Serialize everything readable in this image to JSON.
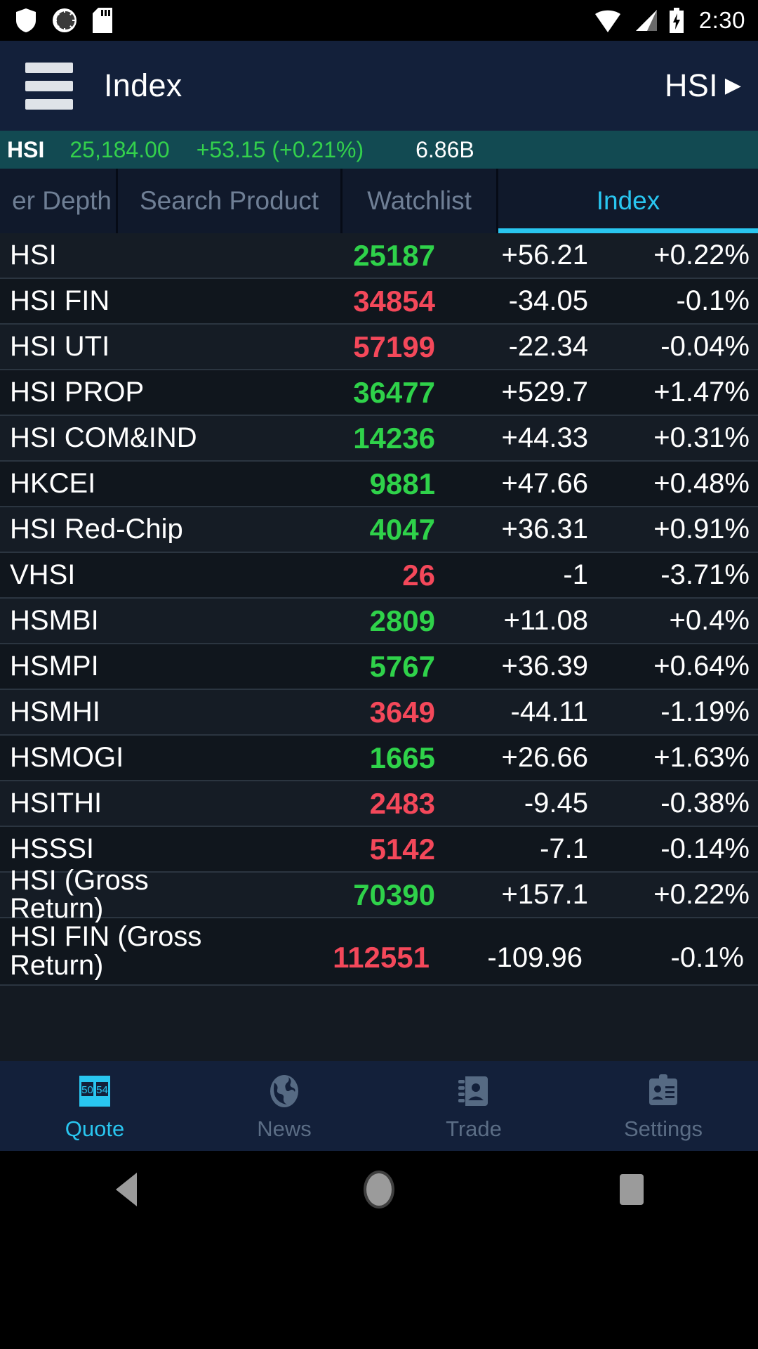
{
  "status_bar": {
    "icons_left": [
      "shield-icon",
      "loading-spinner-icon",
      "sd-card-icon"
    ],
    "icons_right": [
      "wifi-icon",
      "signal-icon",
      "battery-charging-icon"
    ],
    "time": "2:30"
  },
  "app_bar": {
    "menu_icon": "hamburger-menu-icon",
    "title": "Index",
    "symbol": "HSI",
    "arrow_icon": "play-arrow-icon",
    "arrow_glyph": "▶"
  },
  "ticker": {
    "symbol": "HSI",
    "last": "25,184.00",
    "change": "+53.15 (+0.21%)",
    "volume": "6.86B",
    "up_color": "#33d14c"
  },
  "tabs": [
    {
      "label": "er Depth",
      "active": false
    },
    {
      "label": "Search Product",
      "active": false
    },
    {
      "label": "Watchlist",
      "active": false
    },
    {
      "label": "Index",
      "active": true
    }
  ],
  "list": {
    "rows": [
      {
        "name": "HSI",
        "price": "25187",
        "change": "+56.21",
        "percent": "+0.22%",
        "dir": "up"
      },
      {
        "name": "HSI FIN",
        "price": "34854",
        "change": "-34.05",
        "percent": "-0.1%",
        "dir": "down"
      },
      {
        "name": "HSI UTI",
        "price": "57199",
        "change": "-22.34",
        "percent": "-0.04%",
        "dir": "down"
      },
      {
        "name": "HSI PROP",
        "price": "36477",
        "change": "+529.7",
        "percent": "+1.47%",
        "dir": "up"
      },
      {
        "name": "HSI COM&IND",
        "price": "14236",
        "change": "+44.33",
        "percent": "+0.31%",
        "dir": "up"
      },
      {
        "name": "HKCEI",
        "price": "9881",
        "change": "+47.66",
        "percent": "+0.48%",
        "dir": "up"
      },
      {
        "name": "HSI Red-Chip",
        "price": "4047",
        "change": "+36.31",
        "percent": "+0.91%",
        "dir": "up"
      },
      {
        "name": "VHSI",
        "price": "26",
        "change": "-1",
        "percent": "-3.71%",
        "dir": "down"
      },
      {
        "name": "HSMBI",
        "price": "2809",
        "change": "+11.08",
        "percent": "+0.4%",
        "dir": "up"
      },
      {
        "name": "HSMPI",
        "price": "5767",
        "change": "+36.39",
        "percent": "+0.64%",
        "dir": "up"
      },
      {
        "name": "HSMHI",
        "price": "3649",
        "change": "-44.11",
        "percent": "-1.19%",
        "dir": "down"
      },
      {
        "name": "HSMOGI",
        "price": "1665",
        "change": "+26.66",
        "percent": "+1.63%",
        "dir": "up"
      },
      {
        "name": "HSITHI",
        "price": "2483",
        "change": "-9.45",
        "percent": "-0.38%",
        "dir": "down"
      },
      {
        "name": "HSSSI",
        "price": "5142",
        "change": "-7.1",
        "percent": "-0.14%",
        "dir": "down"
      },
      {
        "name": "HSI (Gross Return)",
        "price": "70390",
        "change": "+157.1",
        "percent": "+0.22%",
        "dir": "up"
      },
      {
        "name": "HSI FIN (Gross Return)",
        "price": "112551",
        "change": "-109.96",
        "percent": "-0.1%",
        "dir": "down"
      }
    ],
    "up_color": "#2fd24a",
    "down_color": "#f4485a"
  },
  "bottom_nav": [
    {
      "label": "Quote",
      "icon": "price-board-icon",
      "active": true
    },
    {
      "label": "News",
      "icon": "globe-icon",
      "active": false
    },
    {
      "label": "Trade",
      "icon": "contact-card-icon",
      "active": false
    },
    {
      "label": "Settings",
      "icon": "clipboard-id-icon",
      "active": false
    }
  ],
  "android_nav": {
    "back": "back-triangle-icon",
    "home": "home-circle-icon",
    "recent": "recent-square-icon"
  },
  "theme": {
    "accent": "#29c6f0",
    "appbar": "#13203a",
    "ticker_bg": "#124a52"
  }
}
